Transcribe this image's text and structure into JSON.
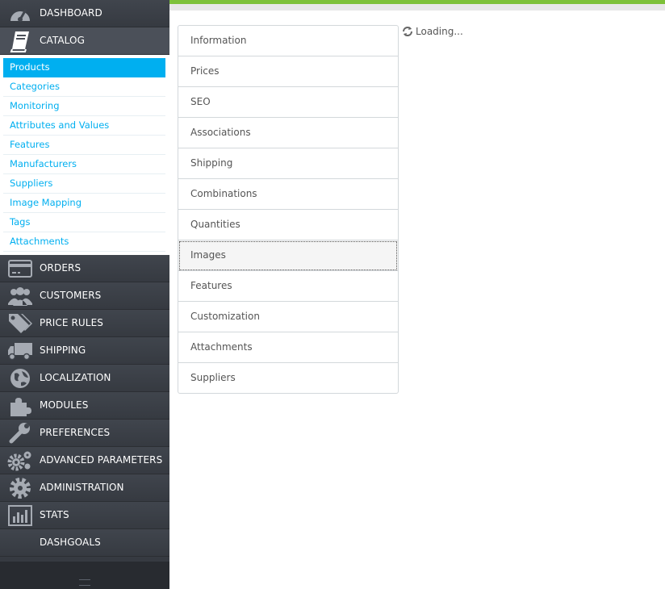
{
  "nav": {
    "dashboard": "DASHBOARD",
    "catalog": "CATALOG",
    "orders": "ORDERS",
    "customers": "CUSTOMERS",
    "price_rules": "PRICE RULES",
    "shipping": "SHIPPING",
    "localization": "LOCALIZATION",
    "modules": "MODULES",
    "preferences": "PREFERENCES",
    "advanced_parameters": "ADVANCED PARAMETERS",
    "administration": "ADMINISTRATION",
    "stats": "STATS",
    "dashgoals": "DASHGOALS"
  },
  "catalog_menu": [
    "Products",
    "Categories",
    "Monitoring",
    "Attributes and Values",
    "Features",
    "Manufacturers",
    "Suppliers",
    "Image Mapping",
    "Tags",
    "Attachments"
  ],
  "tabs": [
    "Information",
    "Prices",
    "SEO",
    "Associations",
    "Shipping",
    "Combinations",
    "Quantities",
    "Images",
    "Features",
    "Customization",
    "Attachments",
    "Suppliers"
  ],
  "loading_text": "Loading...",
  "colors": {
    "sidebar": "#363a41",
    "accent": "#00aff0",
    "topbar_green": "#7dc139"
  }
}
